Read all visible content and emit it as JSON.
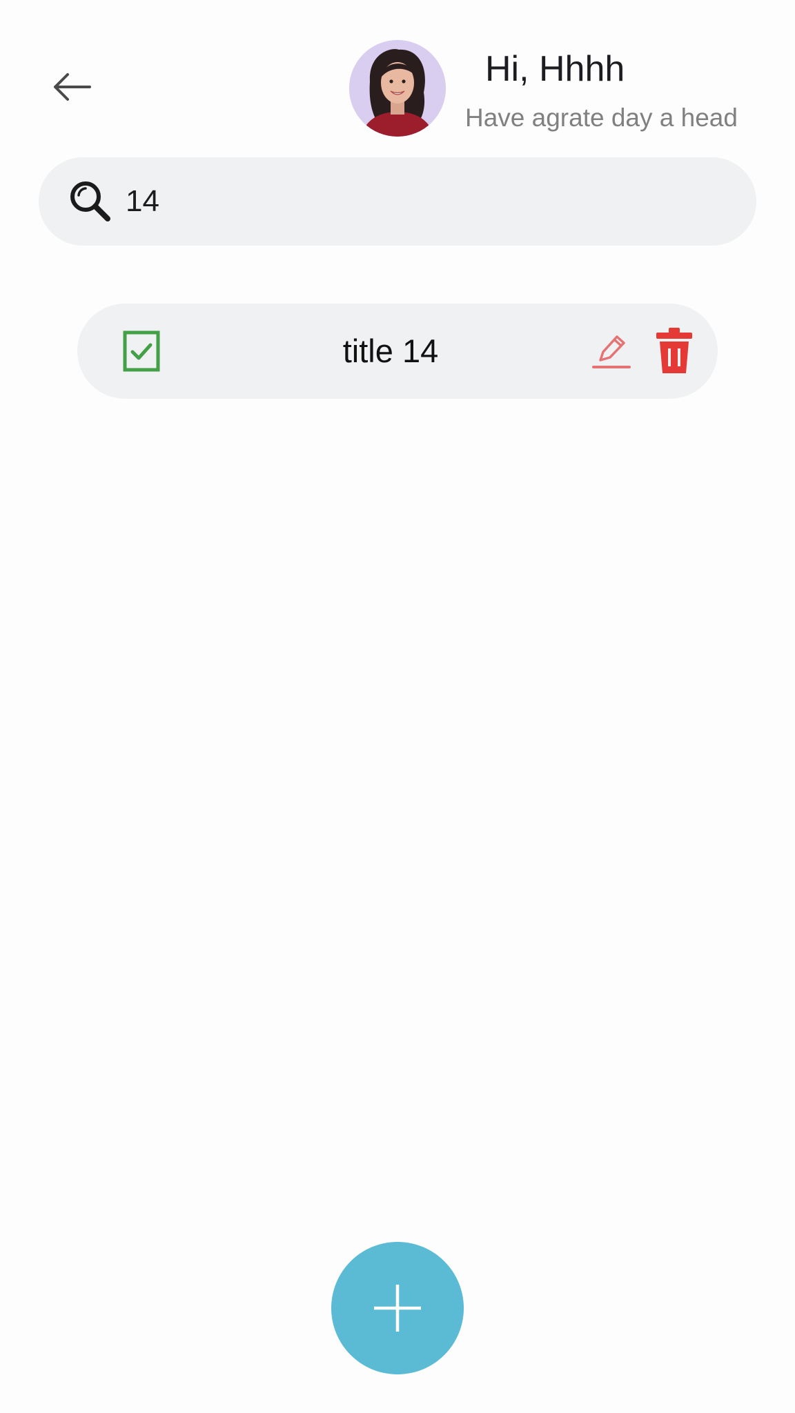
{
  "header": {
    "greeting": "Hi, Hhhh",
    "subtitle": "Have agrate day a head",
    "avatar_icon": "user-avatar-photo",
    "back_icon": "arrow-left-icon"
  },
  "search": {
    "value": "14",
    "placeholder": "",
    "icon": "search-icon"
  },
  "todos": [
    {
      "title": "title 14",
      "completed": true,
      "checkbox_color": "#43a047",
      "edit_color": "#e57373",
      "delete_color": "#e53935"
    }
  ],
  "fab": {
    "icon": "plus-icon",
    "color": "#5bbad4"
  }
}
